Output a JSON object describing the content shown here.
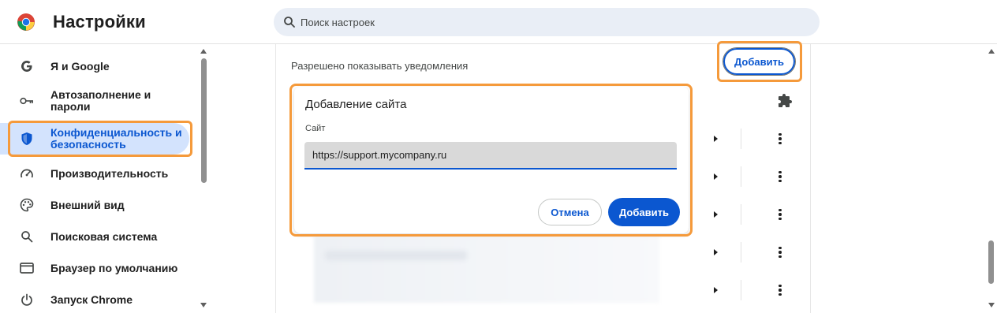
{
  "header": {
    "title": "Настройки",
    "search": {
      "placeholder": "Поиск настроек",
      "value": ""
    }
  },
  "sidebar": {
    "items": [
      {
        "label": "Я и Google",
        "icon": "google-icon",
        "active": false
      },
      {
        "label": "Автозаполнение и пароли",
        "icon": "key-icon",
        "active": false
      },
      {
        "label": "Конфиденциальность и безопасность",
        "icon": "shield-icon",
        "active": true
      },
      {
        "label": "Производительность",
        "icon": "speedometer-icon",
        "active": false
      },
      {
        "label": "Внешний вид",
        "icon": "palette-icon",
        "active": false
      },
      {
        "label": "Поисковая система",
        "icon": "search-icon",
        "active": false
      },
      {
        "label": "Браузер по умолчанию",
        "icon": "browser-window-icon",
        "active": false
      },
      {
        "label": "Запуск Chrome",
        "icon": "power-icon",
        "active": false
      }
    ]
  },
  "main": {
    "section_label": "Разрешено показывать уведомления",
    "add_button_label": "Добавить",
    "row_count": 5
  },
  "dialog": {
    "title": "Добавление сайта",
    "field_label": "Сайт",
    "field_value": "https://support.mycompany.ru",
    "cancel_label": "Отмена",
    "add_label": "Добавить"
  },
  "colors": {
    "accent": "#0b57d0",
    "active_nav_bg": "#d3e3fd",
    "highlight": "#f59a3b",
    "search_bg": "#e9eef6"
  }
}
